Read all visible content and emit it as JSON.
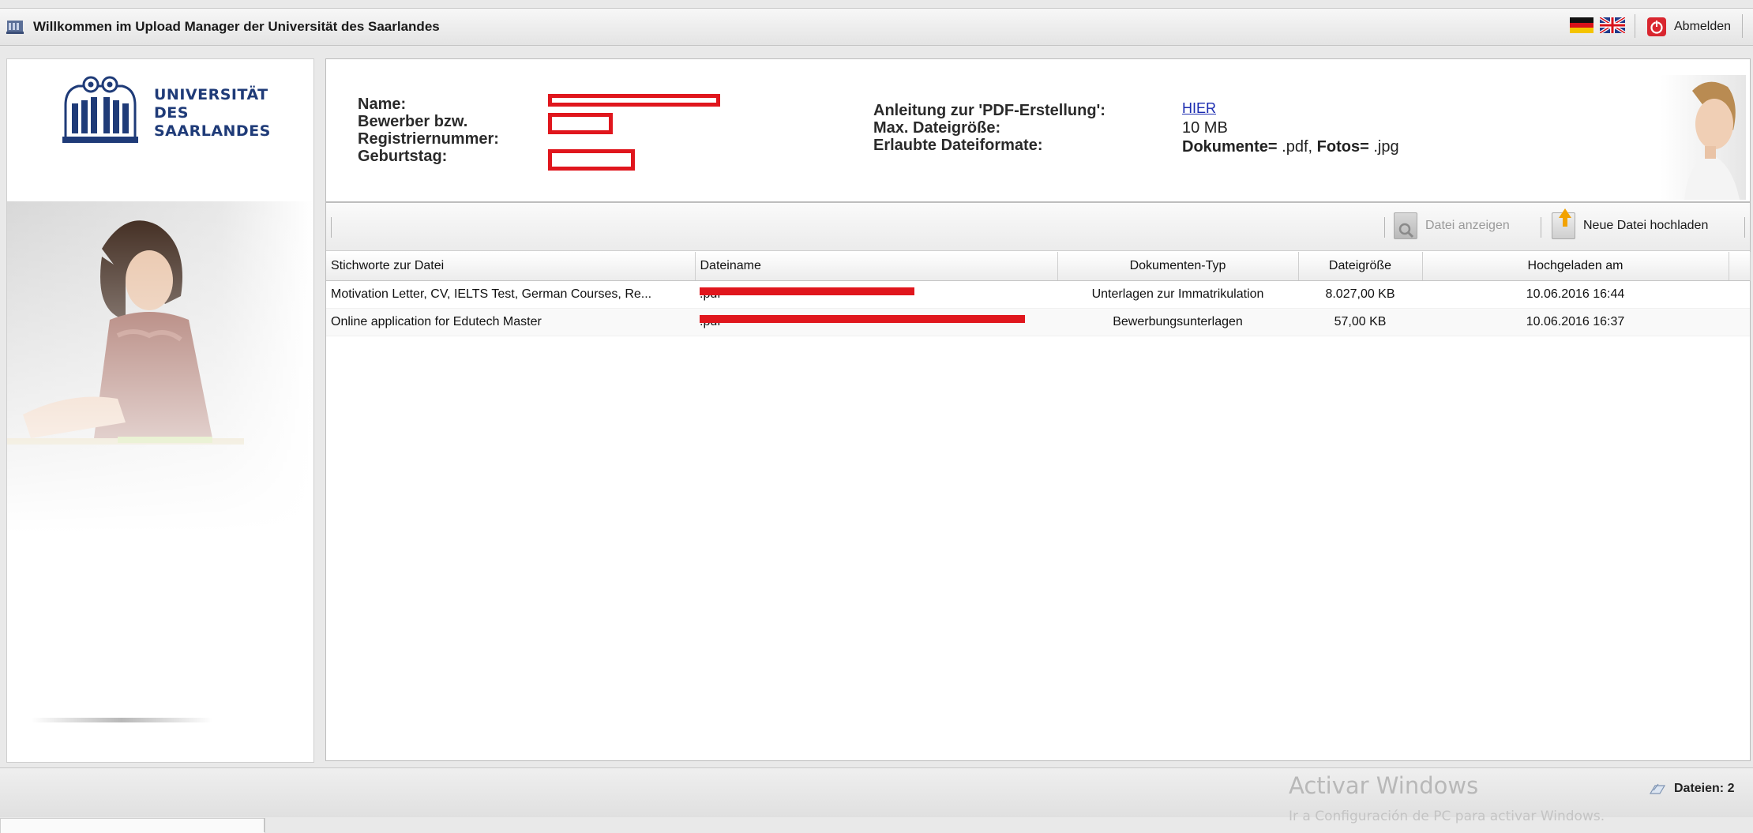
{
  "header": {
    "title": "Willkommen im Upload Manager der Universität des Saarlandes",
    "logout_label": "Abmelden"
  },
  "logo": {
    "line1": "UNIVERSITÄT",
    "line2": "DES",
    "line3": "SAARLANDES"
  },
  "applicant": {
    "name_label": "Name:",
    "id_label_1": "Bewerber bzw.",
    "id_label_2": "Registriernummer:",
    "birthday_label": "Geburtstag:"
  },
  "info": {
    "pdf_label": "Anleitung zur 'PDF-Erstellung':",
    "pdf_link": "HIER",
    "maxsize_label": "Max. Dateigröße:",
    "maxsize_value": "10 MB",
    "formats_label": "Erlaubte Dateiformate:",
    "formats_docs_label": "Dokumente=",
    "formats_docs_value": ".pdf,",
    "formats_photos_label": "Fotos=",
    "formats_photos_value": ".jpg"
  },
  "toolbar": {
    "view_file": "Datei anzeigen",
    "upload_new": "Neue Datei hochladen"
  },
  "table": {
    "columns": [
      "Stichworte zur Datei",
      "Dateiname",
      "Dokumenten-Typ",
      "Dateigröße",
      "Hochgeladen am"
    ],
    "rows": [
      {
        "keywords": "Motivation Letter, CV, IELTS Test, German Courses, Re...",
        "filename_ext": ".pdf",
        "doc_type": "Unterlagen zur Immatrikulation",
        "size": "8.027,00 KB",
        "uploaded": "10.06.2016 16:44"
      },
      {
        "keywords": "Online application for Edutech Master",
        "filename_ext": ".pdf",
        "doc_type": "Bewerbungsunterlagen",
        "size": "57,00 KB",
        "uploaded": "10.06.2016 16:37"
      }
    ]
  },
  "status": {
    "files_count": "Dateien: 2",
    "activate_title": "Activar Windows",
    "activate_sub": "Ir a Configuración de PC para activar Windows."
  },
  "colors": {
    "redaction": "#e0161d",
    "link": "#1a2bb0",
    "type_purple": "#7b1a86",
    "type_blue": "#2f77b8"
  }
}
